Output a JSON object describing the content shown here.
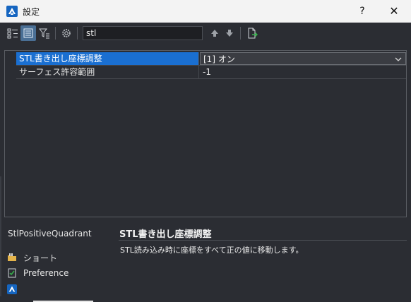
{
  "window": {
    "title": "設定",
    "help_label": "?",
    "close_label": "✕"
  },
  "toolbar": {
    "buttons": [
      {
        "name": "tree-view-icon"
      },
      {
        "name": "list-view-icon"
      },
      {
        "name": "filter-icon"
      },
      {
        "name": "settings-gear-icon"
      }
    ],
    "search_value": "stl",
    "nav_up": "prev-match-icon",
    "nav_down": "next-match-icon",
    "export": "export-icon"
  },
  "grid": {
    "rows": [
      {
        "name": "STL書き出し座標調整",
        "value": "[1] オン",
        "selected": true
      },
      {
        "name": "サーフェス許容範囲",
        "value": "-1",
        "selected": false
      }
    ]
  },
  "details": {
    "variable_name": "StlPositiveQuadrant",
    "title": "STL書き出し座標調整",
    "description": "STL読み込み時に座標をすべて正の値に移動します。"
  },
  "sidebar": {
    "items": [
      {
        "label": "ショート",
        "icon": "folder-icon"
      },
      {
        "label": "Preference",
        "icon": "preference-icon"
      },
      {
        "label": "",
        "icon": "app-logo-icon"
      }
    ]
  },
  "colors": {
    "accent": "#1a6fd1",
    "brand": "#1565c0",
    "background": "#2b2d33"
  }
}
